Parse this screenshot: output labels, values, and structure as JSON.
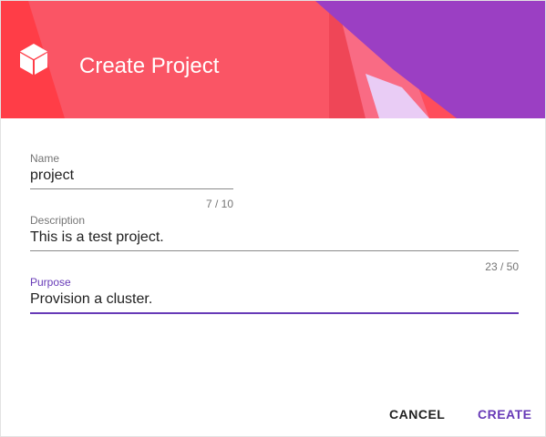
{
  "header": {
    "title": "Create Project",
    "icon": "cube-icon",
    "colors": {
      "red": "#ff4d5b",
      "coral": "#f85b6b",
      "purple": "#9b3fc3",
      "lavender": "#e6c9f3"
    }
  },
  "form": {
    "name": {
      "label": "Name",
      "value": "project",
      "counter": "7 / 10"
    },
    "description": {
      "label": "Description",
      "value": "This is a test project.",
      "counter": "23 / 50"
    },
    "purpose": {
      "label": "Purpose",
      "value": "Provision a cluster.",
      "focused": true
    }
  },
  "actions": {
    "cancel_label": "CANCEL",
    "create_label": "CREATE"
  },
  "accent_color": "#673ab7"
}
